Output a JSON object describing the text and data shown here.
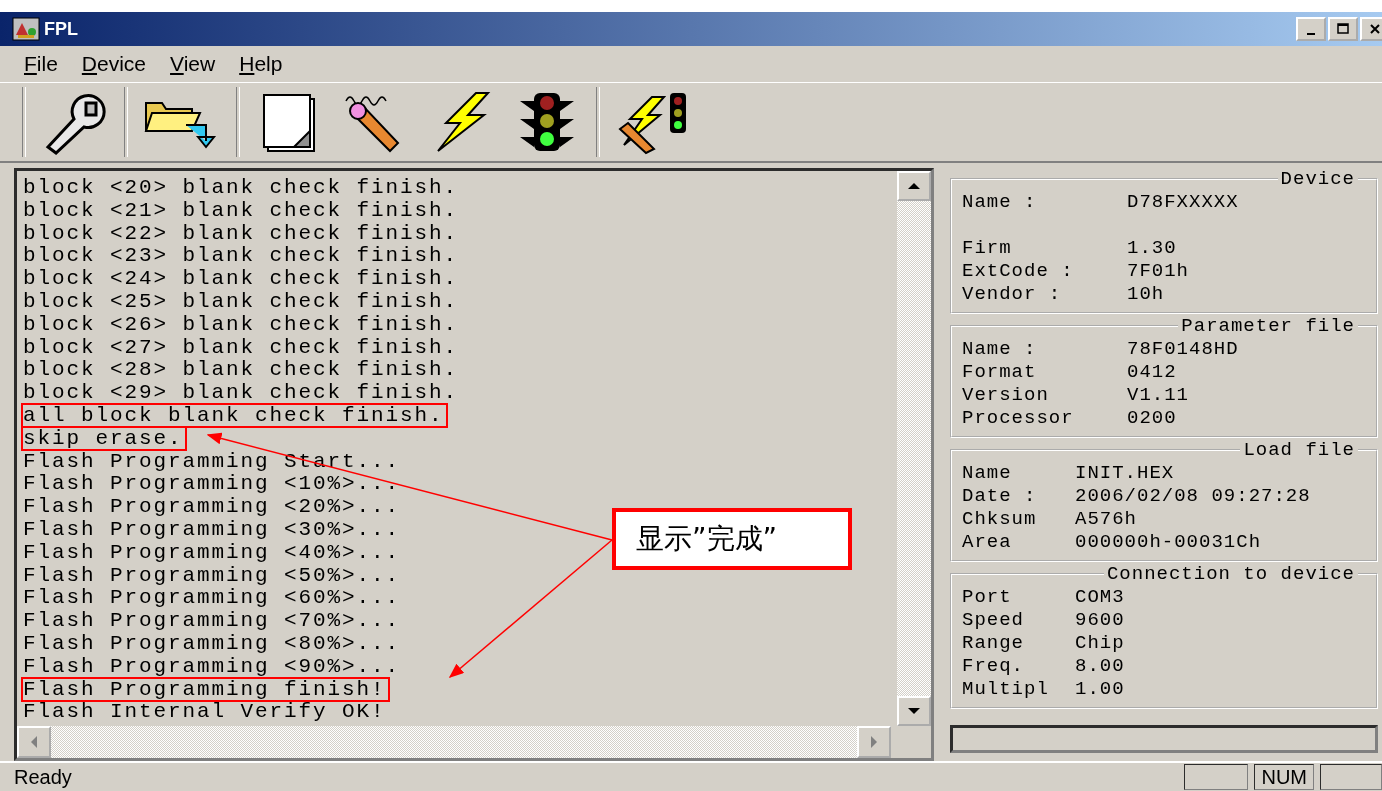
{
  "window": {
    "title": "FPL"
  },
  "menu": [
    "File",
    "Device",
    "View",
    "Help"
  ],
  "toolbar_groups": [
    [
      {
        "kind": "wrench"
      }
    ],
    [
      {
        "kind": "folder"
      }
    ],
    [
      {
        "kind": "page"
      },
      {
        "kind": "pencil"
      },
      {
        "kind": "lightning"
      },
      {
        "kind": "traffic"
      }
    ],
    [
      {
        "kind": "combo"
      }
    ]
  ],
  "log": [
    {
      "text": "block <20> blank check finish.",
      "highlighted": false
    },
    {
      "text": "block <21> blank check finish.",
      "highlighted": false
    },
    {
      "text": "block <22> blank check finish.",
      "highlighted": false
    },
    {
      "text": "block <23> blank check finish.",
      "highlighted": false
    },
    {
      "text": "block <24> blank check finish.",
      "highlighted": false
    },
    {
      "text": "block <25> blank check finish.",
      "highlighted": false
    },
    {
      "text": "block <26> blank check finish.",
      "highlighted": false
    },
    {
      "text": "block <27> blank check finish.",
      "highlighted": false
    },
    {
      "text": "block <28> blank check finish.",
      "highlighted": false
    },
    {
      "text": "block <29> blank check finish.",
      "highlighted": false
    },
    {
      "text": "all block blank check finish.",
      "highlighted": true
    },
    {
      "text": "skip erase.",
      "highlighted": true
    },
    {
      "text": "Flash Programming Start...",
      "highlighted": false
    },
    {
      "text": "Flash Programming <10%>...",
      "highlighted": false
    },
    {
      "text": "Flash Programming <20%>...",
      "highlighted": false
    },
    {
      "text": "Flash Programming <30%>...",
      "highlighted": false
    },
    {
      "text": "Flash Programming <40%>...",
      "highlighted": false
    },
    {
      "text": "Flash Programming <50%>...",
      "highlighted": false
    },
    {
      "text": "Flash Programming <60%>...",
      "highlighted": false
    },
    {
      "text": "Flash Programming <70%>...",
      "highlighted": false
    },
    {
      "text": "Flash Programming <80%>...",
      "highlighted": false
    },
    {
      "text": "Flash Programming <90%>...",
      "highlighted": false
    },
    {
      "text": "Flash Programming finish!",
      "highlighted": true
    },
    {
      "text": "Flash Internal Verify OK!",
      "highlighted": false
    }
  ],
  "info_groups": [
    {
      "title": "Device",
      "fields": [
        {
          "label": "Name :",
          "value": "D78FXXXXX"
        },
        {
          "label": "Firm",
          "value": "1.30"
        },
        {
          "label": "ExtCode :",
          "value": "7F01h"
        },
        {
          "label": "Vendor :",
          "value": "10h"
        }
      ]
    },
    {
      "title": "Parameter file",
      "fields": [
        {
          "label": "Name :",
          "value": "78F0148HD"
        },
        {
          "label": "Format",
          "value": "0412"
        },
        {
          "label": "Version",
          "value": "V1.11"
        },
        {
          "label": "Processor",
          "value": "0200"
        }
      ]
    },
    {
      "title": "Load file",
      "fields": [
        {
          "label": "Name",
          "value": "INIT.HEX"
        },
        {
          "label": "Date :",
          "value": "2006/02/08 09:27:28"
        },
        {
          "label": "Chksum",
          "value": "A576h"
        },
        {
          "label": "Area",
          "value": "000000h-00031Ch"
        }
      ]
    },
    {
      "title": "Connection to device",
      "fields": [
        {
          "label": "Port",
          "value": "COM3"
        },
        {
          "label": "Speed",
          "value": "9600"
        },
        {
          "label": "Range",
          "value": "Chip"
        },
        {
          "label": "Freq.",
          "value": "8.00"
        },
        {
          "label": "Multipl",
          "value": "1.00"
        }
      ]
    }
  ],
  "progress": {
    "level": 0
  },
  "annotation": {
    "text": "显示”完成”"
  },
  "status_bar": {
    "message": "Ready",
    "indicators": [
      "NUM"
    ]
  }
}
